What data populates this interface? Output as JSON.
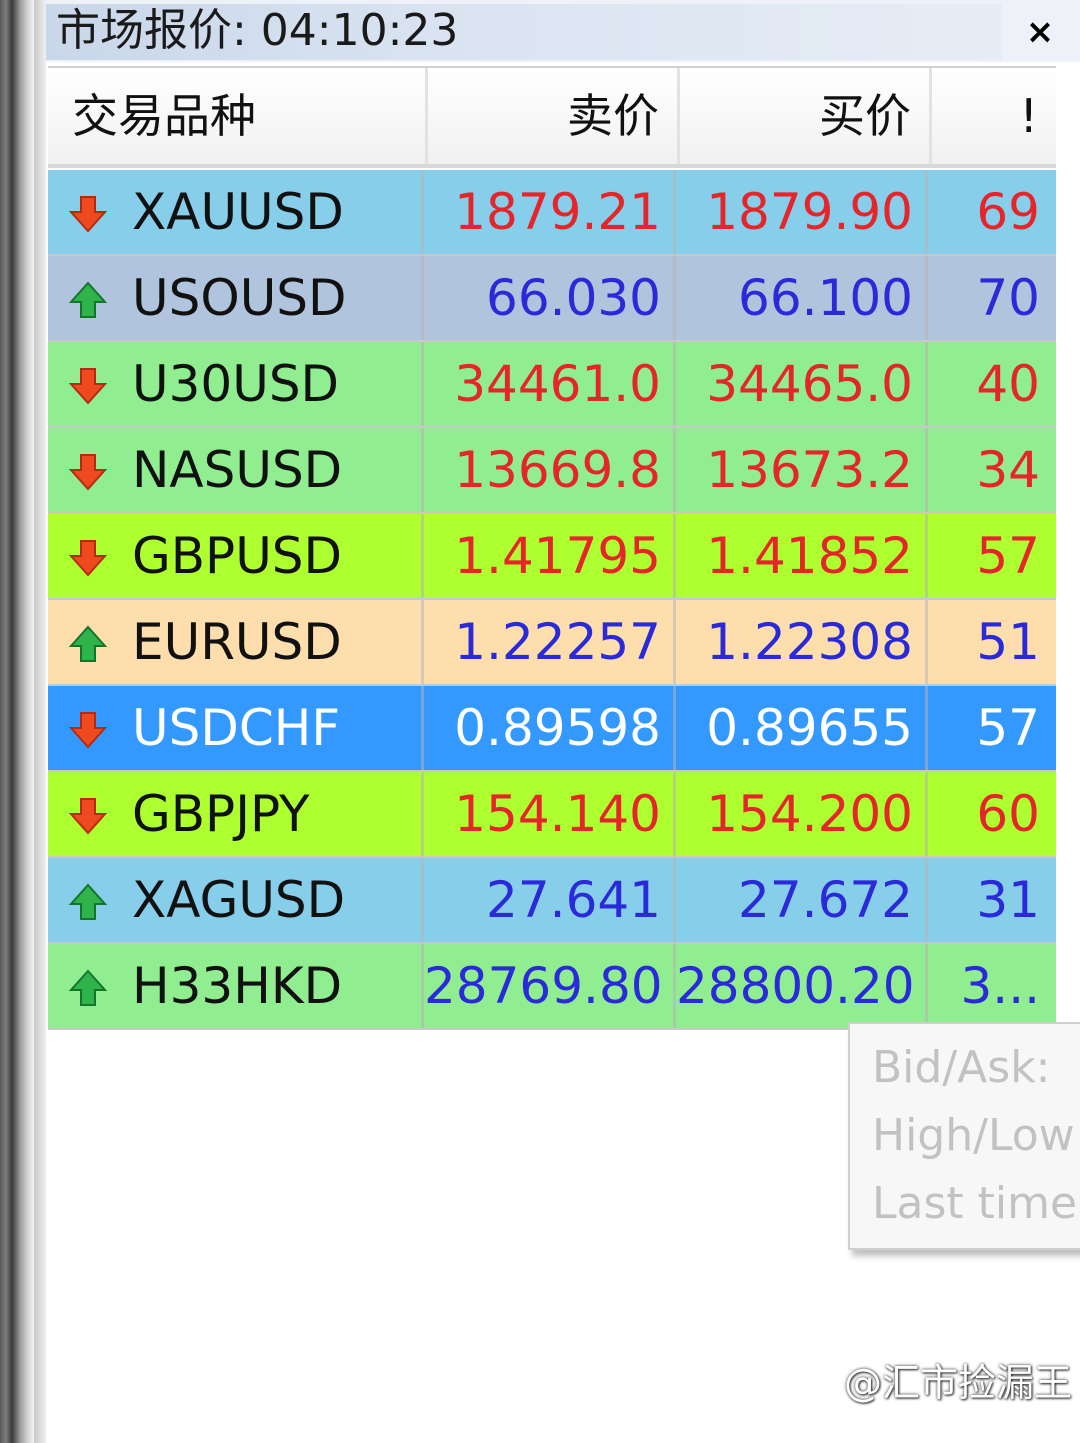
{
  "window": {
    "title": "市场报价: 04:10:23",
    "close_glyph": "×"
  },
  "table": {
    "headers": {
      "symbol": "交易品种",
      "bid": "卖价",
      "ask": "买价",
      "spread": "!"
    },
    "rows": [
      {
        "symbol": "XAUUSD",
        "bid": "1879.21",
        "ask": "1879.90",
        "spread": "69",
        "direction": "down",
        "bg": "#87ceeb"
      },
      {
        "symbol": "USOUSD",
        "bid": "66.030",
        "ask": "66.100",
        "spread": "70",
        "direction": "up",
        "bg": "#b0c4de"
      },
      {
        "symbol": "U30USD",
        "bid": "34461.0",
        "ask": "34465.0",
        "spread": "40",
        "direction": "down",
        "bg": "#90ee90"
      },
      {
        "symbol": "NASUSD",
        "bid": "13669.8",
        "ask": "13673.2",
        "spread": "34",
        "direction": "down",
        "bg": "#90ee90"
      },
      {
        "symbol": "GBPUSD",
        "bid": "1.41795",
        "ask": "1.41852",
        "spread": "57",
        "direction": "down",
        "bg": "#adff2f"
      },
      {
        "symbol": "EURUSD",
        "bid": "1.22257",
        "ask": "1.22308",
        "spread": "51",
        "direction": "up",
        "bg": "#ffdead"
      },
      {
        "symbol": "USDCHF",
        "bid": "0.89598",
        "ask": "0.89655",
        "spread": "57",
        "direction": "down",
        "bg": "#3399ff"
      },
      {
        "symbol": "GBPJPY",
        "bid": "154.140",
        "ask": "154.200",
        "spread": "60",
        "direction": "down",
        "bg": "#adff2f"
      },
      {
        "symbol": "XAGUSD",
        "bid": "27.641",
        "ask": "27.672",
        "spread": "31",
        "direction": "up",
        "bg": "#87ceeb"
      },
      {
        "symbol": "H33HKD",
        "bid": "28769.80",
        "ask": "28800.20",
        "spread": "3...",
        "direction": "up",
        "bg": "#90ee90"
      }
    ]
  },
  "tooltip": {
    "lines": [
      "Bid/Ask:",
      "High/Low",
      "Last time"
    ]
  },
  "watermark": "@汇市捡漏王",
  "icons": {
    "down": "red-down-arrow-icon",
    "up": "green-up-arrow-icon"
  }
}
